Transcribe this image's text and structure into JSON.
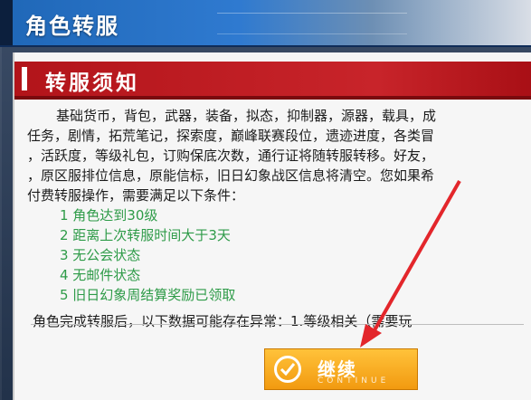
{
  "window": {
    "title": "角色转服"
  },
  "notice": {
    "header": "转服须知",
    "lines": [
      "基础货币，背包，武器，装备，拟态，抑制器，源器，载具，成",
      "任务，剧情，拓荒笔记，探索度，巅峰联赛段位，遗迹进度，各类冒",
      "，活跃度，等级礼包，订购保底次数，通行证将随转服转移。好友，",
      "，原区服排位信息，原能信标，旧日幻象战区信息将清空。您如果希",
      "付费转服操作，需要满足以下条件："
    ],
    "conditions": [
      "1 角色达到30级",
      "2 距离上次转服时间大于3天",
      "3 无公会状态",
      "4 无邮件状态",
      "5 旧日幻象周结算奖励已领取"
    ],
    "footer": "角色完成转服后，以下数据可能存在异常：1.等级相关（需要玩"
  },
  "actions": {
    "continue_label": "继续",
    "continue_sub": "CONTINUE"
  },
  "colors": {
    "header_red": "#c8242a",
    "condition_green": "#2e9b48",
    "button_orange": "#f29a10",
    "annotation_arrow": "#e3262b"
  }
}
